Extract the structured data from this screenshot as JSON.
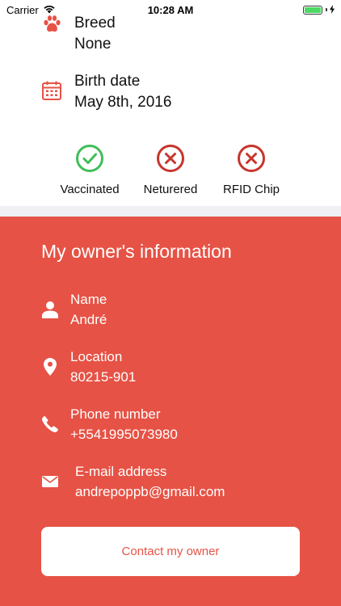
{
  "status_bar": {
    "carrier": "Carrier",
    "time": "10:28 AM",
    "wifi_icon": "wifi-icon",
    "battery_icon": "battery-icon",
    "charging_icon": "charging-bolt-icon"
  },
  "pet_info": [
    {
      "icon": "paw-icon",
      "label": "Breed",
      "value": "None"
    },
    {
      "icon": "calendar-icon",
      "label": "Birth date",
      "value": "May 8th, 2016"
    }
  ],
  "badges": [
    {
      "icon": "check-circle-icon",
      "label": "Vaccinated",
      "status": "yes",
      "color": "#3fbe58"
    },
    {
      "icon": "x-circle-icon",
      "label": "Neturered",
      "status": "no",
      "color": "#c7352c"
    },
    {
      "icon": "x-circle-icon",
      "label": "RFID Chip",
      "status": "no",
      "color": "#c7352c"
    }
  ],
  "owner": {
    "title": "My owner's information",
    "fields": [
      {
        "icon": "person-icon",
        "label": "Name",
        "value": "André"
      },
      {
        "icon": "location-pin-icon",
        "label": "Location",
        "value": "80215-901"
      },
      {
        "icon": "phone-icon",
        "label": "Phone number",
        "value": "+5541995073980"
      },
      {
        "icon": "mail-icon",
        "label": "E-mail address",
        "value": "andrepoppb@gmail.com"
      }
    ],
    "contact_button": "Contact my owner"
  },
  "colors": {
    "accent": "#e65245",
    "positive": "#3fbe58",
    "negative": "#c7352c",
    "divider": "#efeff4"
  }
}
